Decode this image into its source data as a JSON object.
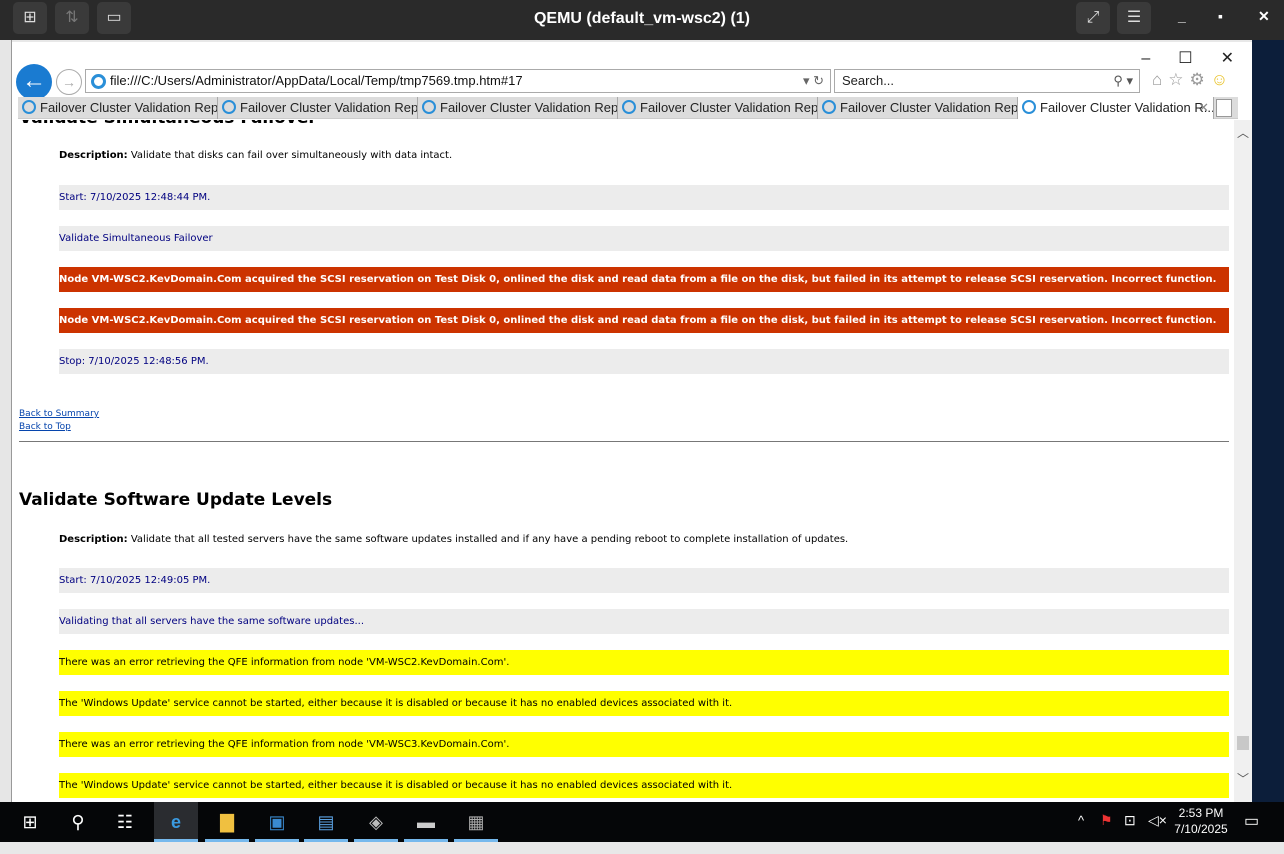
{
  "window": {
    "title": "QEMU (default_vm-wsc2) (1)"
  },
  "browser": {
    "url": "file:///C:/Users/Administrator/AppData/Local/Temp/tmp7569.tmp.htm#17",
    "search_placeholder": "Search...",
    "tabs": [
      "Failover Cluster Validation Rep...",
      "Failover Cluster Validation Rep...",
      "Failover Cluster Validation Rep...",
      "Failover Cluster Validation Rep...",
      "Failover Cluster Validation Rep...",
      "Failover Cluster Validation R..."
    ]
  },
  "content": {
    "section1": {
      "title": "Validate Simultaneous Failover",
      "desc_label": "Description:",
      "desc": " Validate that disks can fail over simultaneously with data intact.",
      "rows": [
        "Start: 7/10/2025 12:48:44 PM.",
        "Validate Simultaneous Failover",
        "Node VM-WSC2.KevDomain.Com acquired the SCSI reservation on Test Disk 0, onlined the disk and read data from a file on the disk, but failed in its attempt to release SCSI reservation. Incorrect function.",
        "Node VM-WSC2.KevDomain.Com acquired the SCSI reservation on Test Disk 0, onlined the disk and read data from a file on the disk, but failed in its attempt to release SCSI reservation. Incorrect function.",
        "Stop: 7/10/2025 12:48:56 PM."
      ]
    },
    "back_summary": "Back to Summary",
    "back_top": "Back to Top",
    "section2": {
      "title": "Validate Software Update Levels",
      "desc_label": "Description:",
      "desc": " Validate that all tested servers have the same software updates installed and if any have a pending reboot to complete installation of updates.",
      "rows": [
        "Start: 7/10/2025 12:49:05 PM.",
        "Validating that all servers have the same software updates...",
        "There was an error retrieving the QFE information from node 'VM-WSC2.KevDomain.Com'.",
        "The 'Windows Update' service cannot be started, either because it is disabled or because it has no enabled devices associated with it.",
        "There was an error retrieving the QFE information from node 'VM-WSC3.KevDomain.Com'.",
        "The 'Windows Update' service cannot be started, either because it is disabled or because it has no enabled devices associated with it."
      ]
    }
  },
  "taskbar": {
    "time": "2:53 PM",
    "date": "7/10/2025"
  },
  "colors": {
    "error": "#cc3300",
    "warning": "#ffff00",
    "info_bg": "#ececec"
  }
}
